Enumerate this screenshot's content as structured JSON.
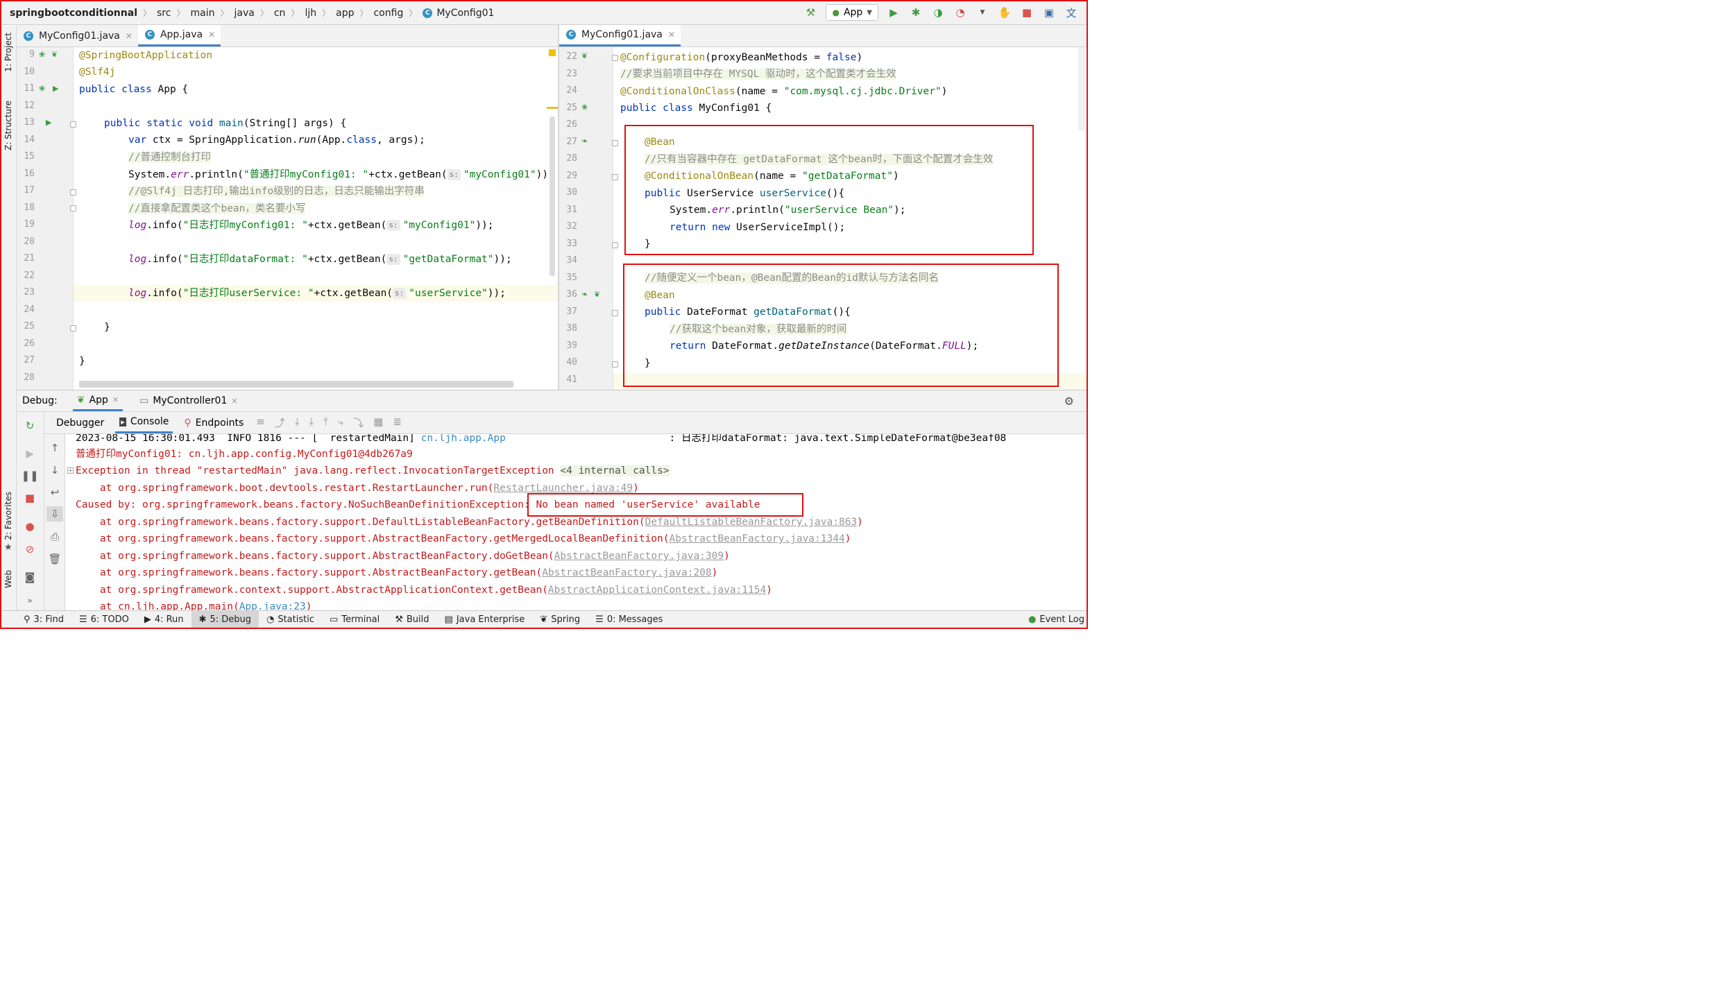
{
  "breadcrumb": [
    "springbootconditionnal",
    "src",
    "main",
    "java",
    "cn",
    "ljh",
    "app",
    "config",
    "MyConfig01"
  ],
  "toolbar": {
    "run_config": "App"
  },
  "left_stripe": [
    "1: Project",
    "Z: Structure",
    "2: Favorites",
    "Web"
  ],
  "left_editor": {
    "tabs": [
      {
        "label": "MyConfig01.java",
        "active": false
      },
      {
        "label": "App.java",
        "active": true
      }
    ],
    "line_numbers": [
      "9",
      "10",
      "11",
      "12",
      "13",
      "14",
      "15",
      "16",
      "17",
      "18",
      "19",
      "20",
      "21",
      "22",
      "23",
      "24",
      "25",
      "26",
      "27",
      "28"
    ],
    "code": {
      "l9": "@SpringBootApplication",
      "l10": "@Slf4j",
      "l11a": "public class",
      "l11b": " App {",
      "l13a": "public static void",
      "l13b": " main",
      "l13c": "(String[] args) {",
      "l14a": "var",
      "l14b": " ctx = SpringApplication.",
      "l14c": "run",
      "l14d": "(App.",
      "l14e": "class",
      "l14f": ", args);",
      "l15": "//普通控制台打印",
      "l16a": "System.",
      "l16b": "err",
      "l16c": ".println(",
      "l16d": "\"普通打印myConfig01: \"",
      "l16e": "+ctx.getBean(",
      "l16f": "\"myConfig01\"",
      "l16g": "));",
      "l17": "//@Slf4j 日志打印,输出info级别的日志，日志只能输出字符串",
      "l18": "//直接拿配置类这个bean，类名要小写",
      "l19a": "log",
      "l19b": ".info(",
      "l19c": "\"日志打印myConfig01: \"",
      "l19d": "+ctx.getBean(",
      "l19e": "\"myConfig01\"",
      "l19f": "));",
      "l21a": "log",
      "l21b": ".info(",
      "l21c": "\"日志打印dataFormat: \"",
      "l21d": "+ctx.getBean(",
      "l21e": "\"getDataFormat\"",
      "l21f": "));",
      "l23a": "log",
      "l23b": ".info(",
      "l23c": "\"日志打印userService: \"",
      "l23d": "+ctx.getBean(",
      "l23e": "\"userService\"",
      "l23f": "));",
      "l25": "}",
      "l27": "}",
      "hint": "s:"
    }
  },
  "right_editor": {
    "tabs": [
      {
        "label": "MyConfig01.java",
        "active": true
      }
    ],
    "line_numbers": [
      "22",
      "23",
      "24",
      "25",
      "26",
      "27",
      "28",
      "29",
      "30",
      "31",
      "32",
      "33",
      "34",
      "35",
      "36",
      "37",
      "38",
      "39",
      "40",
      "41"
    ],
    "code": {
      "r22a": "@Configuration",
      "r22b": "(proxyBeanMethods = ",
      "r22c": "false",
      "r22d": ")",
      "r23": "//要求当前项目中存在 MYSQL 驱动时，这个配置类才会生效",
      "r24a": "@ConditionalOnClass",
      "r24b": "(name = ",
      "r24c": "\"com.mysql.cj.jdbc.Driver\"",
      "r24d": ")",
      "r25a": "public class",
      "r25b": " MyConfig01 {",
      "r27": "@Bean",
      "r28": "//只有当容器中存在 getDataFormat 这个bean时，下面这个配置才会生效",
      "r29a": "@ConditionalOnBean",
      "r29b": "(name = ",
      "r29c": "\"getDataFormat\"",
      "r29d": ")",
      "r30a": "public",
      "r30b": " UserService ",
      "r30c": "userService",
      "r30d": "(){",
      "r31a": "System.",
      "r31b": "err",
      "r31c": ".println(",
      "r31d": "\"userService Bean\"",
      "r31e": ");",
      "r32a": "return new",
      "r32b": " UserServiceImpl();",
      "r33": "}",
      "r35": "//随便定义一个bean，@Bean配置的Bean的id默认与方法名同名",
      "r36": "@Bean",
      "r37a": "public",
      "r37b": " DateFormat ",
      "r37c": "getDataFormat",
      "r37d": "(){",
      "r38": "//获取这个bean对象，获取最新的时间",
      "r39a": "return",
      "r39b": " DateFormat.",
      "r39c": "getDateInstance",
      "r39d": "(DateFormat.",
      "r39e": "FULL",
      "r39f": ");",
      "r40": "}"
    }
  },
  "debug": {
    "label": "Debug:",
    "sessions": [
      "App",
      "MyController01"
    ],
    "tabs": [
      "Debugger",
      "Console",
      "Endpoints"
    ],
    "console": {
      "c0a": "2023-08-15 16:30:01.493  INFO 1816 --- [  restartedMain] ",
      "c0b": "cn.ljh.app.App",
      "c0c": "                           : 日志打印dataFormat: java.text.SimpleDateFormat@be3eaf08",
      "c1": "普通打印myConfig01: cn.ljh.app.config.MyConfig01@4db267a9",
      "c2a": "Exception in thread \"restartedMain\" java.lang.reflect.InvocationTargetException ",
      "c2b": "<4 internal calls>",
      "c3a": "    at org.springframework.boot.devtools.restart.RestartLauncher.run(",
      "c3b": "RestartLauncher.java:49",
      "c3c": ")",
      "c4a": "Caused by: org.springframework.beans.factory.NoSuchBeanDefinitionException",
      "c4b": ": No bean named 'userService' available",
      "c5a": "    at org.springframework.beans.factory.support.DefaultListableBeanFactory.getBeanDefinition(",
      "c5b": "DefaultListableBeanFactory.java:863",
      "c5c": ")",
      "c6a": "    at org.springframework.beans.factory.support.AbstractBeanFactory.getMergedLocalBeanDefinition(",
      "c6b": "AbstractBeanFactory.java:1344",
      "c6c": ")",
      "c7a": "    at org.springframework.beans.factory.support.AbstractBeanFactory.doGetBean(",
      "c7b": "AbstractBeanFactory.java:309",
      "c7c": ")",
      "c8a": "    at org.springframework.beans.factory.support.AbstractBeanFactory.getBean(",
      "c8b": "AbstractBeanFactory.java:208",
      "c8c": ")",
      "c9a": "    at org.springframework.context.support.AbstractApplicationContext.getBean(",
      "c9b": "AbstractApplicationContext.java:1154",
      "c9c": ")",
      "c10a": "    at cn.ljh.app.App.main(",
      "c10b": "App.java:23",
      "c10c": ")"
    }
  },
  "bottom_tabs": [
    "3: Find",
    "6: TODO",
    "4: Run",
    "5: Debug",
    "Statistic",
    "Terminal",
    "Build",
    "Java Enterprise",
    "Spring",
    "0: Messages"
  ],
  "event_log": "Event Log",
  "colors": {
    "keyword": "#0033b3",
    "annotation": "#9e880d",
    "string": "#067d17",
    "comment": "#8c8c8c",
    "error": "#c41a1a",
    "highlight_box": "#e01010"
  }
}
